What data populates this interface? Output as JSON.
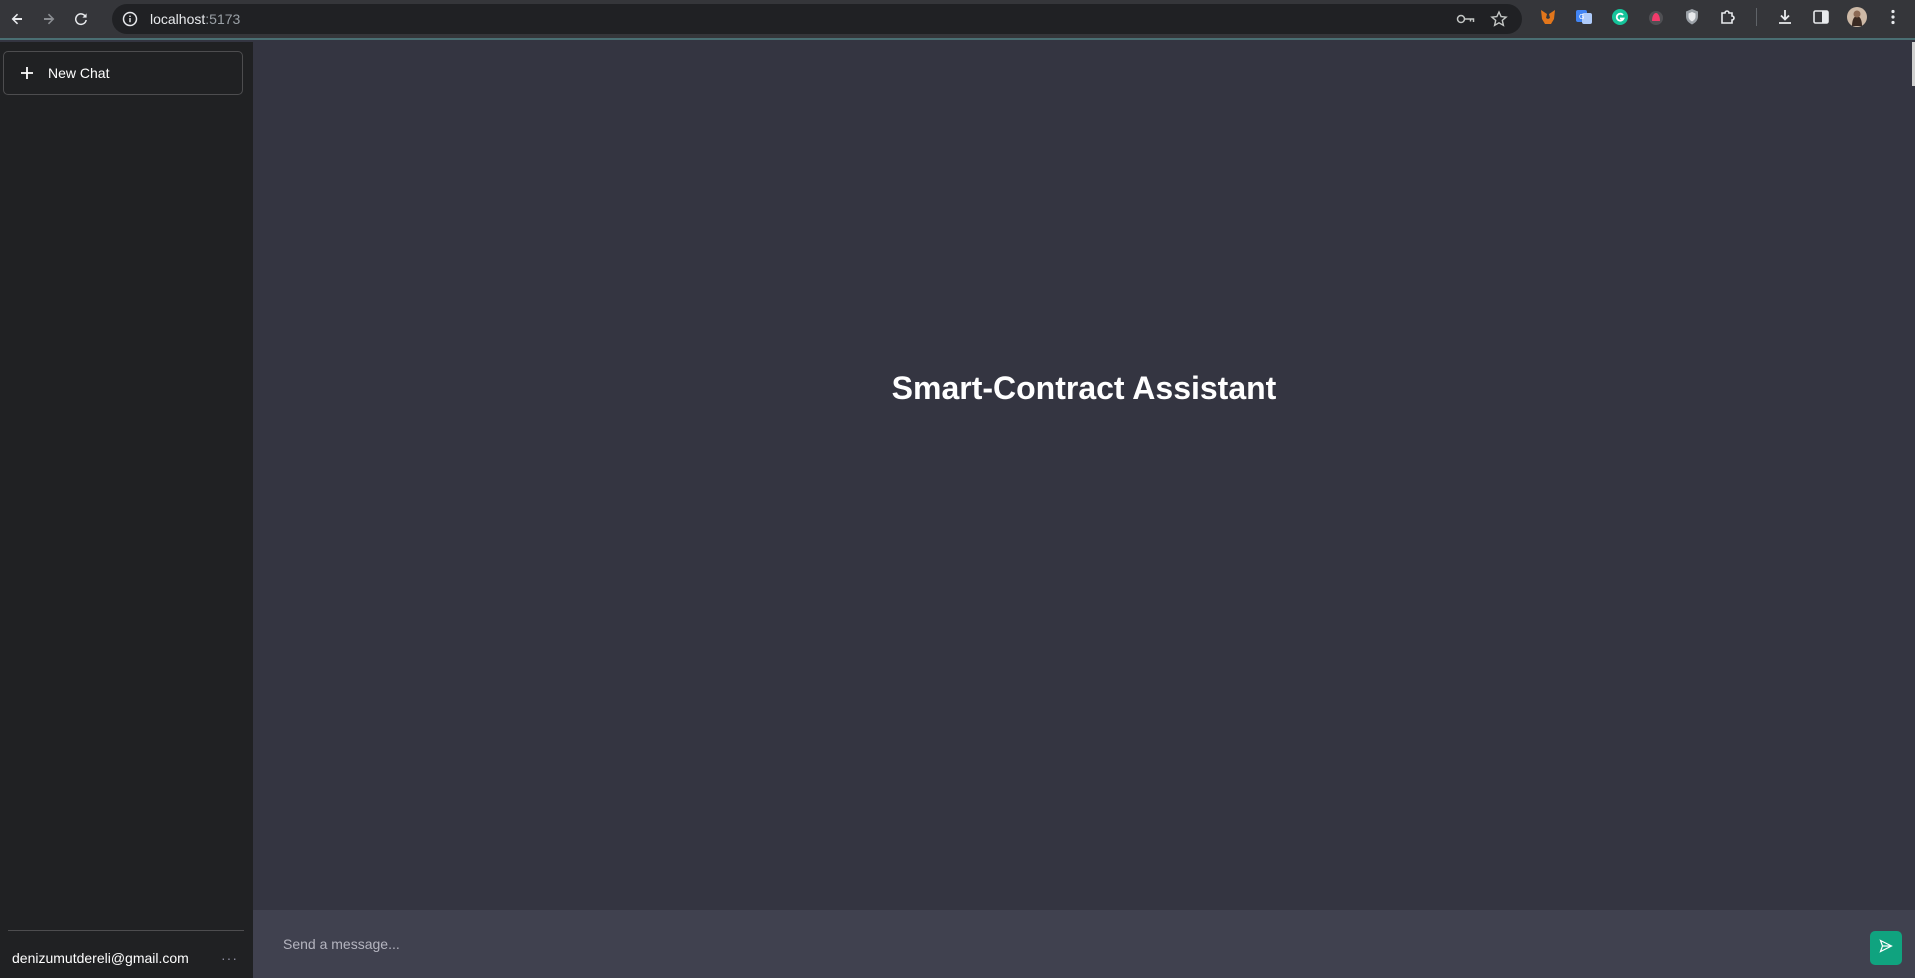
{
  "browser": {
    "url_host": "localhost",
    "url_port": ":5173"
  },
  "sidebar": {
    "new_chat_label": "New Chat",
    "user_email": "denizumutdereli@gmail.com",
    "more_label": "···"
  },
  "main": {
    "title": "Smart-Contract Assistant"
  },
  "composer": {
    "placeholder": "Send a message..."
  },
  "colors": {
    "sidebar_bg": "#202123",
    "main_bg": "#343541",
    "input_bg": "#40414f",
    "send_accent": "#10a37f"
  }
}
